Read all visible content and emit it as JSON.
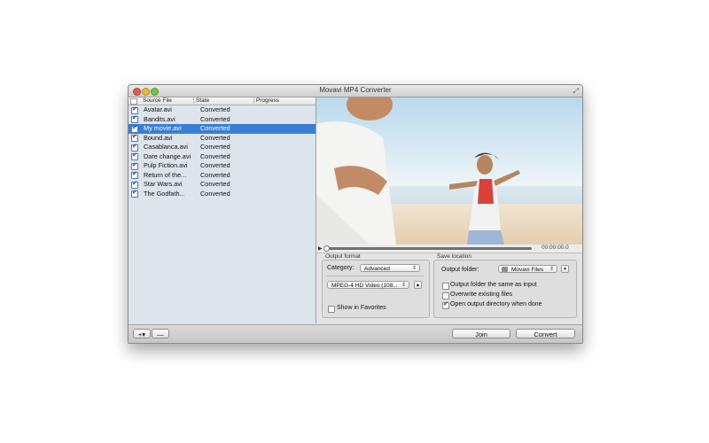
{
  "window": {
    "title": "Movavi MP4 Converter"
  },
  "file_list": {
    "columns": [
      "Source File",
      "State",
      "Progress"
    ],
    "rows": [
      {
        "name": "Avatar.avi",
        "state": "Converted",
        "checked": true,
        "selected": false
      },
      {
        "name": "Bandits.avi",
        "state": "Converted",
        "checked": true,
        "selected": false
      },
      {
        "name": "My movie.avi",
        "state": "Converted",
        "checked": true,
        "selected": true
      },
      {
        "name": "Bound.avi",
        "state": "Converted",
        "checked": true,
        "selected": false
      },
      {
        "name": "Casablanca.avi",
        "state": "Converted",
        "checked": true,
        "selected": false
      },
      {
        "name": "Dare change.avi",
        "state": "Converted",
        "checked": true,
        "selected": false
      },
      {
        "name": "Pulp Fiction.avi",
        "state": "Converted",
        "checked": true,
        "selected": false
      },
      {
        "name": "Return of the...",
        "state": "Converted",
        "checked": true,
        "selected": false
      },
      {
        "name": "Star Wars.avi",
        "state": "Converted",
        "checked": true,
        "selected": false
      },
      {
        "name": "The Godfath...",
        "state": "Converted",
        "checked": true,
        "selected": false
      }
    ]
  },
  "player": {
    "time": "00:00:00.0",
    "position": 0
  },
  "output_format": {
    "heading": "Output format",
    "category_label": "Category:",
    "category_value": "Advanced",
    "format_value": "MPEG-4 HD Video (108...",
    "show_favorites_label": "Show in Favorites",
    "show_favorites_checked": false
  },
  "save_location": {
    "heading": "Save location",
    "folder_label": "Output folder:",
    "folder_value": "Movavi Files",
    "same_as_input_label": "Output folder the same as input",
    "same_as_input_checked": false,
    "overwrite_label": "Overwrite existing files",
    "overwrite_checked": false,
    "open_dir_label": "Open output directory when done",
    "open_dir_checked": true
  },
  "toolbar": {
    "add_label": "+▾",
    "remove_label": "—",
    "join_label": "Join",
    "convert_label": "Convert"
  },
  "colors": {
    "selection": "#3a7fd6",
    "progress": "#3b86e0"
  }
}
